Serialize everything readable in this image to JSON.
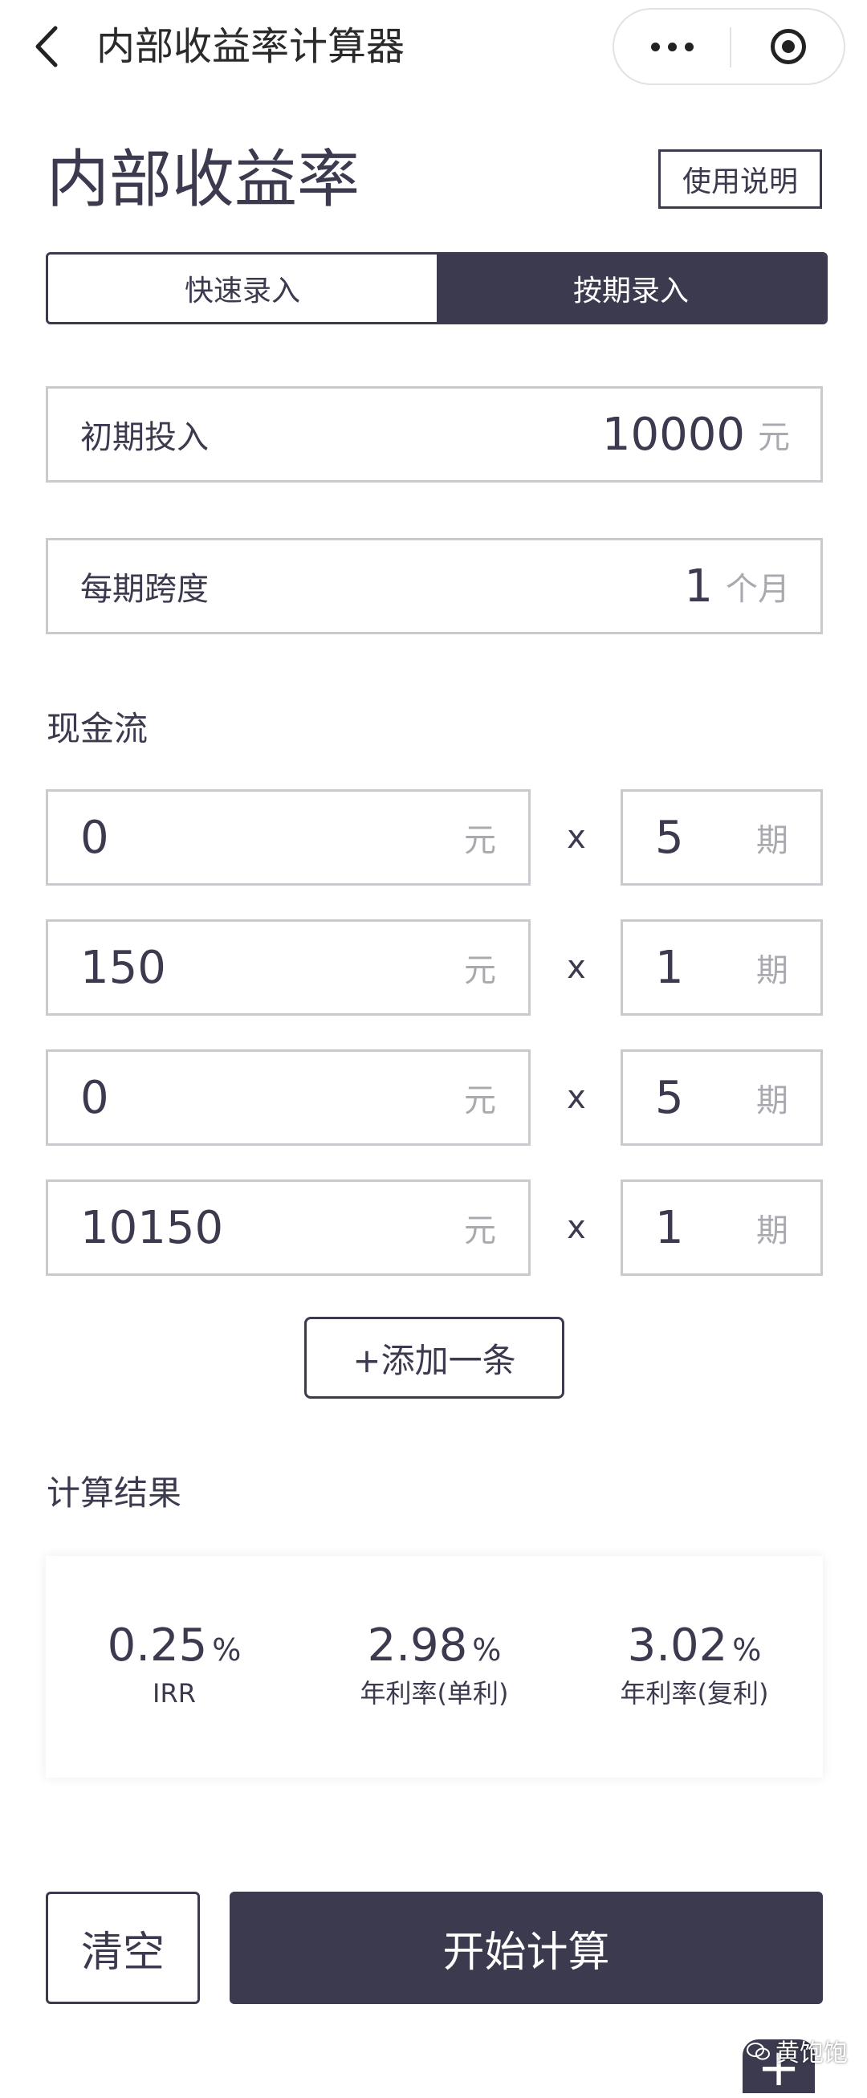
{
  "nav": {
    "title": "内部收益率计算器",
    "back_icon": "chevron-left-icon",
    "more_icon": "more-dots-icon",
    "close_icon": "target-close-icon"
  },
  "page": {
    "title": "内部收益率",
    "help_label": "使用说明"
  },
  "tabs": [
    {
      "label": "快速录入",
      "active": false
    },
    {
      "label": "按期录入",
      "active": true
    }
  ],
  "initial": {
    "label": "初期投入",
    "value": "10000",
    "unit": "元"
  },
  "period": {
    "label": "每期跨度",
    "value": "1",
    "unit": "个月"
  },
  "cashflow": {
    "label": "现金流",
    "rows": [
      {
        "amount": "0",
        "amount_unit": "元",
        "times": "x",
        "count": "5",
        "count_unit": "期"
      },
      {
        "amount": "150",
        "amount_unit": "元",
        "times": "x",
        "count": "1",
        "count_unit": "期"
      },
      {
        "amount": "0",
        "amount_unit": "元",
        "times": "x",
        "count": "5",
        "count_unit": "期"
      },
      {
        "amount": "10150",
        "amount_unit": "元",
        "times": "x",
        "count": "1",
        "count_unit": "期"
      }
    ],
    "add_label": "+添加一条"
  },
  "results": {
    "label": "计算结果",
    "items": [
      {
        "value": "0.25",
        "unit": "%",
        "caption": "IRR"
      },
      {
        "value": "2.98",
        "unit": "%",
        "caption": "年利率(单利)"
      },
      {
        "value": "3.02",
        "unit": "%",
        "caption": "年利率(复利)"
      }
    ]
  },
  "actions": {
    "clear_label": "清空",
    "start_label": "开始计算"
  },
  "watermark": "黄饱饱",
  "colors": {
    "primary": "#3b3a4e",
    "border": "#c9c9ce",
    "unit_gray": "#a9a9b0"
  }
}
